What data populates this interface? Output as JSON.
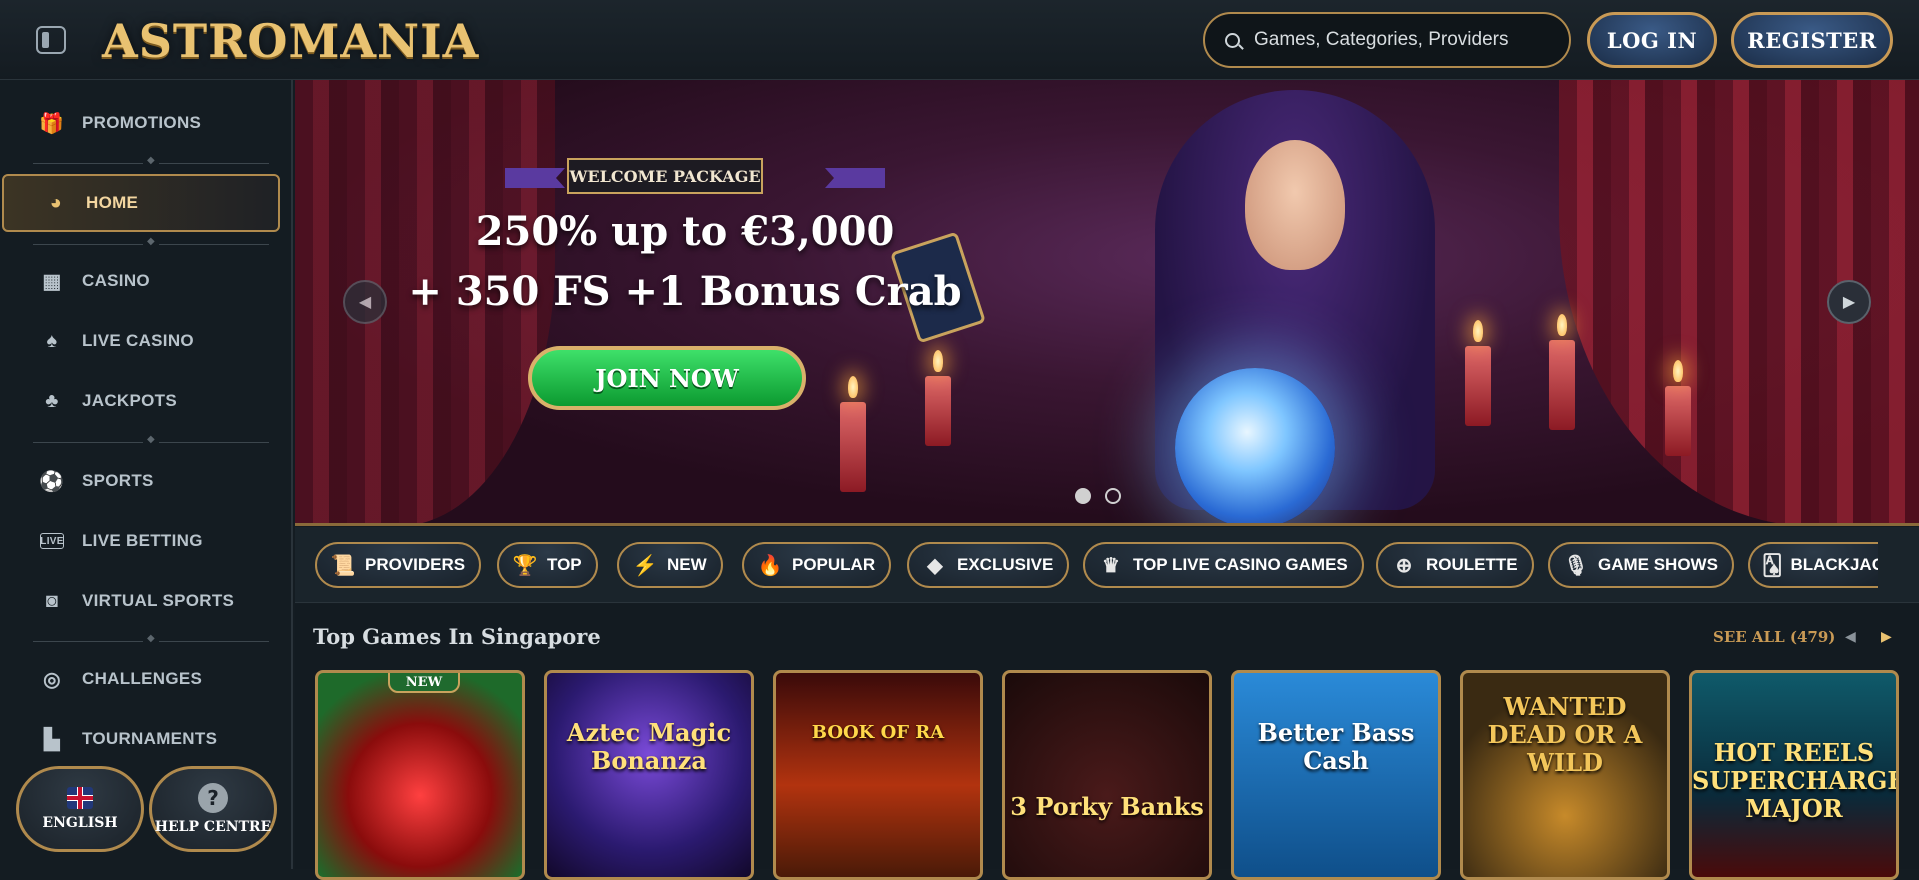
{
  "header": {
    "logo": "ASTROMANIA",
    "search_placeholder": "Games, Categories, Providers",
    "login_label": "LOG IN",
    "register_label": "REGISTER"
  },
  "sidebar": {
    "items": [
      {
        "label": "PROMOTIONS",
        "icon": "gift-icon"
      },
      {
        "label": "HOME",
        "icon": "crystal-ball-icon",
        "active": true
      },
      {
        "label": "CASINO",
        "icon": "slot-machine-icon"
      },
      {
        "label": "LIVE CASINO",
        "icon": "card-icon"
      },
      {
        "label": "JACKPOTS",
        "icon": "clover-icon"
      },
      {
        "label": "SPORTS",
        "icon": "soccer-ball-icon"
      },
      {
        "label": "LIVE BETTING",
        "icon": "live-icon"
      },
      {
        "label": "VIRTUAL SPORTS",
        "icon": "virtual-ball-icon"
      },
      {
        "label": "CHALLENGES",
        "icon": "target-icon"
      },
      {
        "label": "TOURNAMENTS",
        "icon": "podium-icon"
      }
    ],
    "language_label": "ENGLISH",
    "help_label": "HELP CENTRE"
  },
  "banner": {
    "package_label": "WELCOME PACKAGE",
    "headline_line1": "250% up to €3,000",
    "headline_line2": "+ 350 FS +1 Bonus Crab",
    "cta_label": "JOIN NOW",
    "slide_count": 2,
    "active_slide": 1
  },
  "categories": [
    {
      "label": "PROVIDERS",
      "icon": "scroll-icon"
    },
    {
      "label": "TOP",
      "icon": "trophy-icon"
    },
    {
      "label": "NEW",
      "icon": "lightning-icon"
    },
    {
      "label": "POPULAR",
      "icon": "flame-icon"
    },
    {
      "label": "EXCLUSIVE",
      "icon": "diamond-icon"
    },
    {
      "label": "TOP LIVE CASINO GAMES",
      "icon": "crown-icon"
    },
    {
      "label": "ROULETTE",
      "icon": "roulette-icon"
    },
    {
      "label": "GAME SHOWS",
      "icon": "microphone-icon"
    },
    {
      "label": "BLACKJACK",
      "icon": "cards-icon"
    }
  ],
  "games_section": {
    "title": "Top Games In Singapore",
    "see_all_label": "SEE ALL (479)",
    "games": [
      {
        "name": "",
        "badge": "NEW"
      },
      {
        "name": "Aztec Magic Bonanza",
        "badge": ""
      },
      {
        "name": "BOOK OF RA",
        "badge": ""
      },
      {
        "name": "3 Porky Banks",
        "badge": ""
      },
      {
        "name": "Better Bass Cash",
        "badge": ""
      },
      {
        "name": "WANTED DEAD OR A WILD",
        "badge": ""
      },
      {
        "name": "HOT REELS SUPERCHARGED MAJOR",
        "badge": ""
      }
    ]
  },
  "colors": {
    "accent_gold": "#b08a4d",
    "background": "#141c22",
    "cta_green": "#0c9a30",
    "button_blue": "#1b2d47"
  }
}
